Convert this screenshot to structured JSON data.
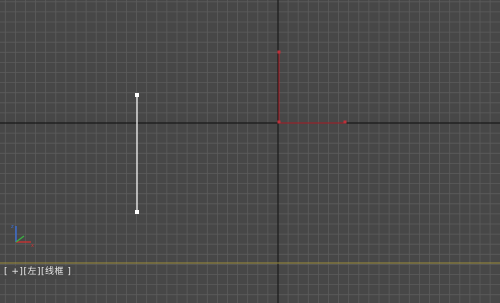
{
  "viewport": {
    "label": "[ +][左][线框 ]",
    "label_parts": {
      "plus": "[ +]",
      "view": "[左]",
      "shading": "[线框 ]"
    },
    "icons": {
      "axis_gizmo": "xyz-axis-gizmo-icon"
    }
  },
  "colors": {
    "background": "#474747",
    "grid_minor": "#5c5c5c",
    "grid_major": "#6a6a6a",
    "axis_lines": "#1a1a1a",
    "selected_object": "#ffffff",
    "red_object": "#b3262f",
    "horizon_line": "#9c8e3a"
  }
}
